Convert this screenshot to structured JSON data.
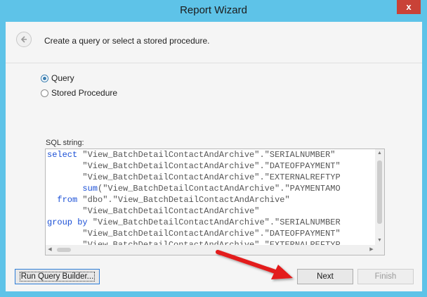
{
  "window": {
    "title": "Report Wizard",
    "close_label": "x"
  },
  "header": {
    "instruction": "Create a query or select a stored procedure."
  },
  "options": [
    {
      "label": "Query",
      "checked": true
    },
    {
      "label": "Stored Procedure",
      "checked": false
    }
  ],
  "sql": {
    "label": "SQL string:",
    "lines": [
      {
        "kw": "select",
        "rest": " \"View_BatchDetailContactAndArchive\".\"SERIALNUMBER\""
      },
      {
        "kw": "",
        "rest": "       \"View_BatchDetailContactAndArchive\".\"DATEOFPAYMENT\""
      },
      {
        "kw": "",
        "rest": "       \"View_BatchDetailContactAndArchive\".\"EXTERNALREFTYP"
      },
      {
        "kw": "       sum",
        "rest": "(\"View_BatchDetailContactAndArchive\".\"PAYMENTAMO"
      },
      {
        "kw": "  from",
        "rest": " \"dbo\".\"View_BatchDetailContactAndArchive\""
      },
      {
        "kw": "",
        "rest": "       \"View_BatchDetailContactAndArchive\""
      },
      {
        "kw": "group by",
        "rest": " \"View_BatchDetailContactAndArchive\".\"SERIALNUMBER"
      },
      {
        "kw": "",
        "rest": "       \"View_BatchDetailContactAndArchive\".\"DATEOFPAYMENT\""
      },
      {
        "kw": "",
        "rest": "       \"View_BatchDetailContactAndArchive\".\"EXTERNALREFTYP"
      }
    ]
  },
  "buttons": {
    "query_builder": "Run Query Builder...",
    "next": "Next",
    "finish": "Finish"
  },
  "colors": {
    "accent": "#5ec3e8",
    "keyword": "#1a4fd6",
    "annotation_arrow": "#e31b1b"
  }
}
